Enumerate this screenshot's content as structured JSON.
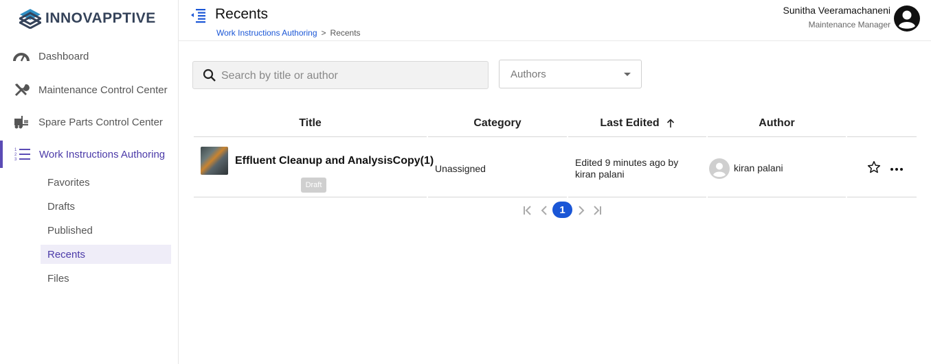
{
  "brand": {
    "name": "INNOVAPPTIVE",
    "logo_icon": "innovapptive-logo"
  },
  "sidebar": {
    "items": [
      {
        "label": "Dashboard",
        "icon": "gauge-icon"
      },
      {
        "label": "Maintenance Control Center",
        "icon": "tools-icon"
      },
      {
        "label": "Spare Parts Control Center",
        "icon": "forklift-icon"
      },
      {
        "label": "Work Instructions Authoring",
        "icon": "numbered-list-icon",
        "active": true
      }
    ],
    "subitems": [
      {
        "label": "Favorites"
      },
      {
        "label": "Drafts"
      },
      {
        "label": "Published"
      },
      {
        "label": "Recents",
        "selected": true
      },
      {
        "label": "Files"
      }
    ]
  },
  "header": {
    "title": "Recents",
    "breadcrumb": {
      "parent": "Work Instructions Authoring",
      "separator": ">",
      "current": "Recents"
    },
    "user": {
      "name": "Sunitha Veeramachaneni",
      "role": "Maintenance Manager"
    }
  },
  "filters": {
    "search_placeholder": "Search by title or author",
    "authors_label": "Authors"
  },
  "table": {
    "columns": {
      "title": "Title",
      "category": "Category",
      "last_edited": "Last Edited",
      "author": "Author"
    },
    "sort": {
      "column": "Last Edited",
      "direction": "ascending"
    },
    "rows": [
      {
        "title": "Effluent Cleanup and AnalysisCopy(1)",
        "status": "Draft",
        "category": "Unassigned",
        "edited_line1": "Edited 9 minutes ago by",
        "edited_line2": "kiran palani",
        "author": "kiran palani"
      }
    ]
  },
  "pagination": {
    "current_page": "1"
  },
  "colors": {
    "accent": "#5b4bb5",
    "link": "#1a56d6",
    "brand_text": "#35435a"
  }
}
